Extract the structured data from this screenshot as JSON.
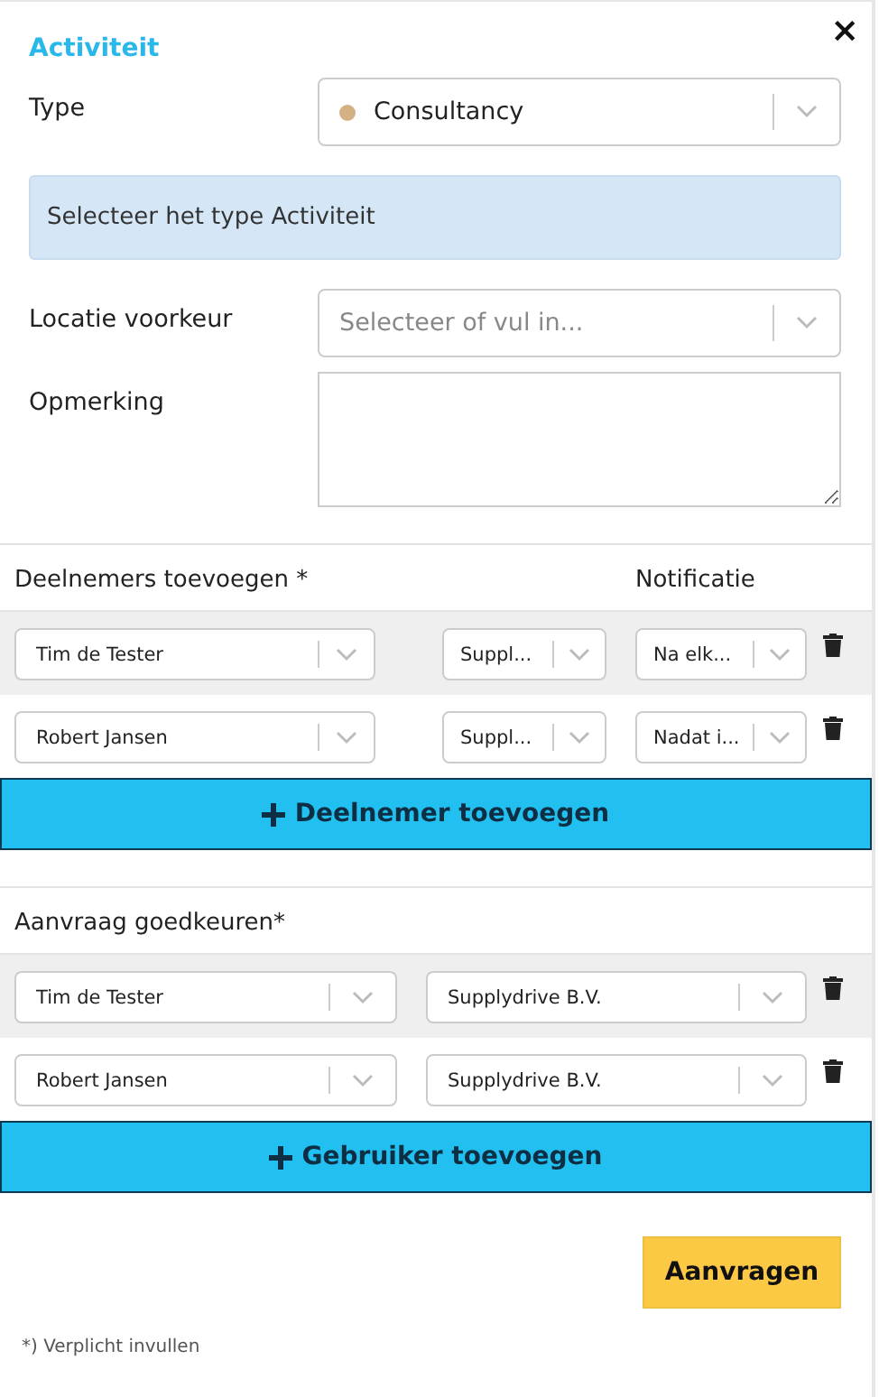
{
  "title": "Activiteit",
  "close": "×",
  "fields": [
    {
      "label": "Type",
      "kind": "select",
      "value": "Consultancy",
      "color": "#d4b184"
    },
    {
      "kind": "info",
      "text": "Selecteer het type Activiteit"
    },
    {
      "label": "Locatie voorkeur",
      "kind": "select",
      "placeholder": "Selecteer of vul in..."
    },
    {
      "label": "Opmerking",
      "kind": "textarea"
    }
  ],
  "participants": {
    "heading": "Deelnemers toevoegen *",
    "column_notification": "Notificatie",
    "rows": [
      {
        "name": "Tim de Tester",
        "company": "Suppl...",
        "notification": "Na elk..."
      },
      {
        "name": "Robert Jansen",
        "company": "Suppl...",
        "notification": "Nadat i..."
      }
    ],
    "add_button": "Deelnemer toevoegen"
  },
  "approvers": {
    "heading": "Aanvraag goedkeuren*",
    "rows": [
      {
        "name": "Tim de Tester",
        "company": "Supplydrive B.V."
      },
      {
        "name": "Robert Jansen",
        "company": "Supplydrive B.V."
      }
    ],
    "add_button": "Gebruiker toevoegen"
  },
  "submit_button": "Aanvragen",
  "footnote": "*) Verplicht invullen"
}
